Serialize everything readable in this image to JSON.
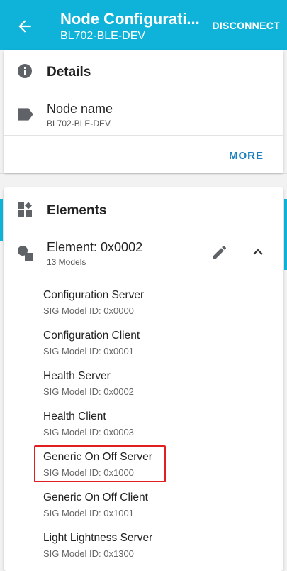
{
  "appbar": {
    "title": "Node Configurati...",
    "subtitle": "BL702-BLE-DEV",
    "disconnect_label": "DISCONNECT"
  },
  "details_card": {
    "header": "Details",
    "node_name_label": "Node name",
    "node_name_value": "BL702-BLE-DEV",
    "more_label": "MORE"
  },
  "elements_card": {
    "header": "Elements",
    "element_title": "Element: 0x0002",
    "element_subtitle": "13 Models",
    "models": [
      {
        "name": "Configuration Server",
        "id": "SIG Model ID: 0x0000"
      },
      {
        "name": "Configuration Client",
        "id": "SIG Model ID: 0x0001"
      },
      {
        "name": "Health Server",
        "id": "SIG Model ID: 0x0002"
      },
      {
        "name": "Health Client",
        "id": "SIG Model ID: 0x0003"
      },
      {
        "name": "Generic On Off Server",
        "id": "SIG Model ID: 0x1000"
      },
      {
        "name": "Generic On Off Client",
        "id": "SIG Model ID: 0x1001"
      },
      {
        "name": "Light Lightness Server",
        "id": "SIG Model ID: 0x1300"
      }
    ]
  },
  "colors": {
    "appbar": "#0fb3d9",
    "accent_text": "#1a7fbf",
    "highlight": "#e02020"
  }
}
